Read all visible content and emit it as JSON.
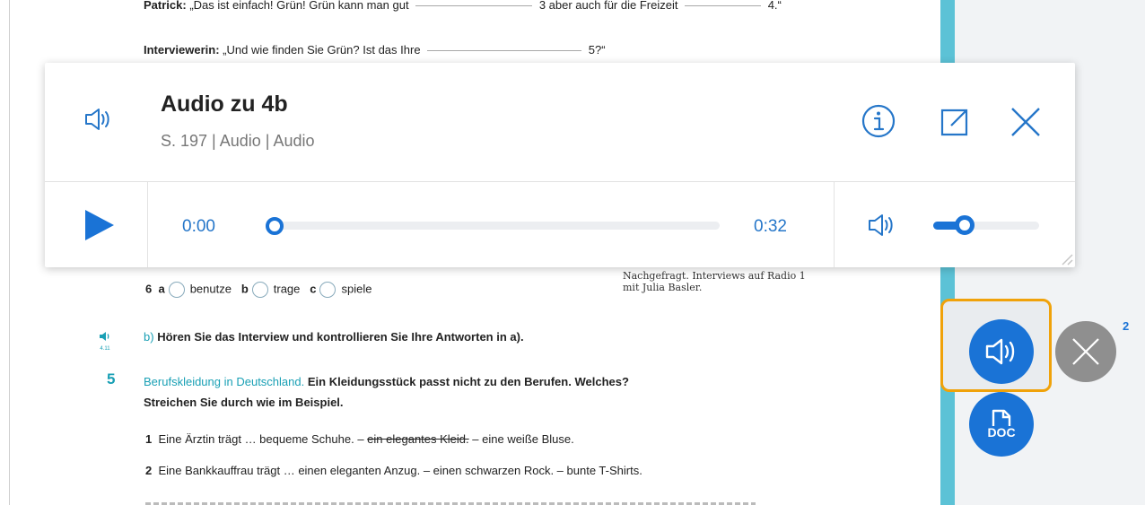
{
  "document": {
    "line1": {
      "speaker": "Patrick:",
      "text_a": "„Das ist einfach! Grün! Grün kann man gut",
      "text_b": "3 aber auch für die Freizeit",
      "text_c": "4.“"
    },
    "line2": {
      "speaker": "Interviewerin:",
      "text_a": "„Und wie finden Sie Grün? Ist das Ihre",
      "text_b": "5?“"
    },
    "option_row": {
      "number": "6",
      "options": [
        {
          "letter": "a",
          "word": "benutze"
        },
        {
          "letter": "b",
          "word": "trage"
        },
        {
          "letter": "c",
          "word": "spiele"
        }
      ]
    },
    "credit_line1": "Nachgefragt. Interviews auf Radio 1",
    "credit_line2": "mit Julia Basler.",
    "track_label": "4.11",
    "task_b": {
      "prefix": "b)",
      "text": "Hören Sie das Interview und kontrollieren Sie Ihre Antworten in a)."
    },
    "exercise5": {
      "number": "5",
      "topic": "Berufskleidung in Deutschland.",
      "instruction_a": "Ein Kleidungsstück passt nicht zu den Berufen. Welches?",
      "instruction_b": "Streichen Sie durch wie im Beispiel."
    },
    "item1": {
      "number": "1",
      "start": "Eine Ärztin trägt … bequeme Schuhe. –",
      "struck": "ein elegantes Kleid.",
      "end": "– eine weiße Bluse."
    },
    "item2": {
      "number": "2",
      "text": "Eine Bankkauffrau trägt … einen eleganten Anzug. – einen schwarzen Rock. – bunte T-Shirts."
    }
  },
  "player": {
    "title": "Audio zu 4b",
    "subtitle": "S. 197 | Audio | Audio",
    "current_time": "0:00",
    "duration": "0:32",
    "progress": 0.0,
    "volume": 0.3,
    "accent_color": "#1a73d6",
    "icons": [
      "speaker-icon",
      "info-icon",
      "external-link-icon",
      "close-icon",
      "play-icon",
      "volume-icon",
      "resize-handle-icon"
    ]
  },
  "side_panel": {
    "doc_label": "DOC",
    "badge_count": "2",
    "highlight_color": "#f0a20a",
    "stripe_color": "#5cc2d6"
  }
}
